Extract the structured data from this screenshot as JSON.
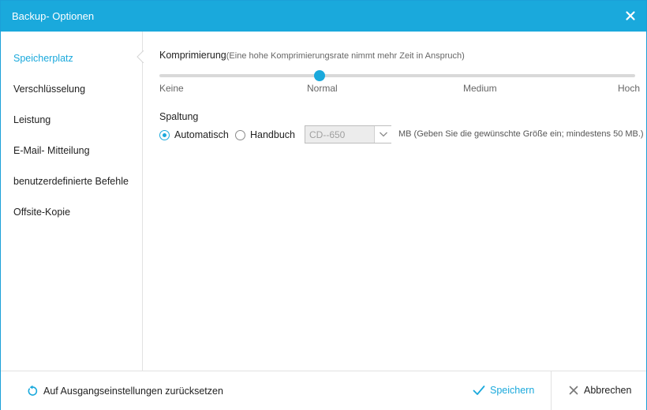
{
  "window": {
    "title": "Backup- Optionen",
    "close_icon": "close-icon"
  },
  "sidebar": {
    "items": [
      {
        "label": "Speicherplatz",
        "active": true
      },
      {
        "label": "Verschlüsselung",
        "active": false
      },
      {
        "label": "Leistung",
        "active": false
      },
      {
        "label": "E-Mail- Mitteilung",
        "active": false
      },
      {
        "label": "benutzerdefinierte Befehle",
        "active": false
      },
      {
        "label": "Offsite-Kopie",
        "active": false
      }
    ]
  },
  "compression": {
    "label": "Komprimierung",
    "hint": "(Eine hohe Komprimierungsrate nimmt mehr Zeit in Anspruch)",
    "levels": [
      "Keine",
      "Normal",
      "Medium",
      "Hoch"
    ],
    "selected_level": "Normal",
    "selected_index": 1
  },
  "split": {
    "label": "Spaltung",
    "options": [
      {
        "label": "Automatisch",
        "checked": true
      },
      {
        "label": "Handbuch",
        "checked": false
      }
    ],
    "select_value": "CD--650",
    "mb_hint": "MB (Geben Sie die gewünschte  Größe ein; mindestens 50 MB.)"
  },
  "footer": {
    "reset_label": "Auf Ausgangseinstellungen zurücksetzen",
    "save_label": "Speichern",
    "cancel_label": "Abbrechen"
  },
  "colors": {
    "accent": "#1aa9dc",
    "title_bar": "#1aa9dc",
    "text": "#222222",
    "muted": "#666666"
  }
}
